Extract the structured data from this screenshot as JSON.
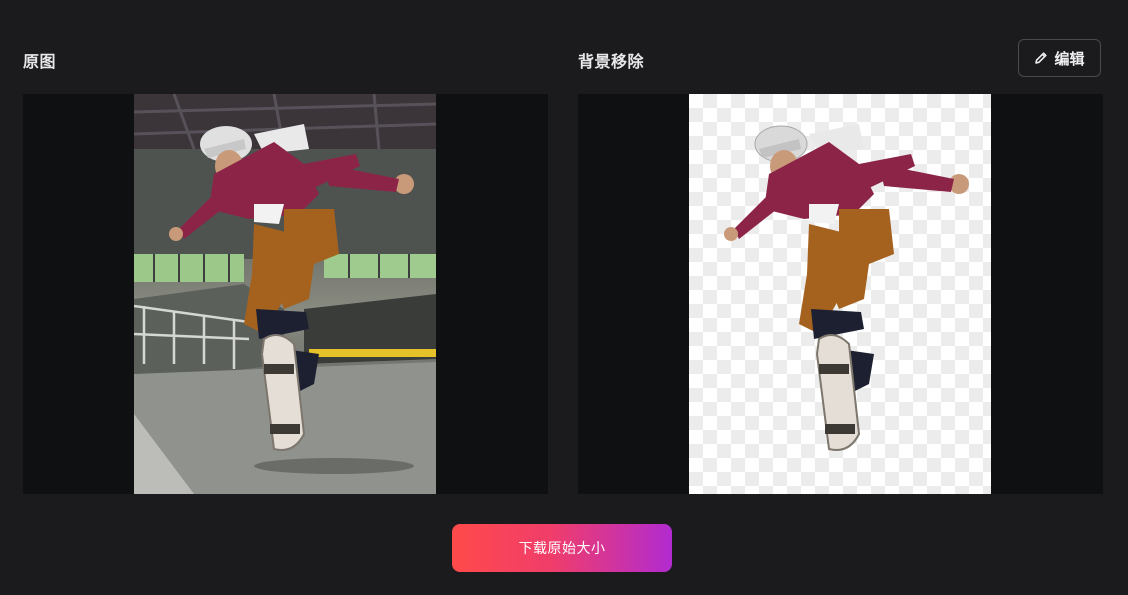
{
  "panels": {
    "original_title": "原图",
    "result_title": "背景移除"
  },
  "toolbar": {
    "edit_label": "编辑",
    "edit_icon": "pencil-icon"
  },
  "actions": {
    "download_label": "下载原始大小"
  },
  "colors": {
    "background": "#1b1b1e",
    "frame": "#0f1012",
    "download_gradient_start": "#ff4a4a",
    "download_gradient_end": "#b22bd0"
  }
}
